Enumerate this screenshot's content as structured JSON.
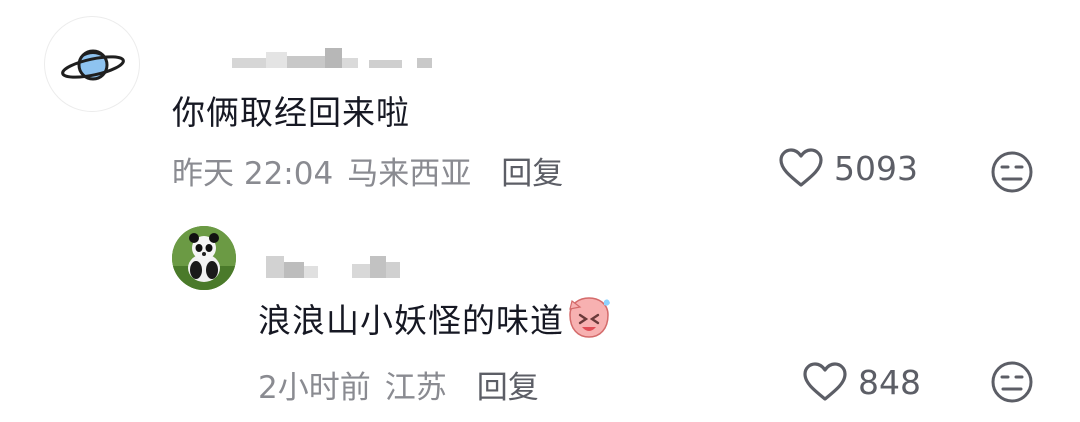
{
  "comment": {
    "text": "你俩取经回来啦",
    "time": "昨天 22:04",
    "location": "马来西亚",
    "reply_label": "回复",
    "likes": "5093"
  },
  "reply_comment": {
    "text": "浪浪山小妖怪的味道",
    "time": "2小时前",
    "location": "江苏",
    "reply_label": "回复",
    "likes": "848"
  },
  "colors": {
    "meta": "#8a8b91",
    "text": "#161823",
    "icon": "#5c5e66"
  },
  "icons": [
    "planet-icon",
    "heart-icon",
    "neutral-face-icon",
    "panda-avatar",
    "crying-emoji-icon"
  ]
}
